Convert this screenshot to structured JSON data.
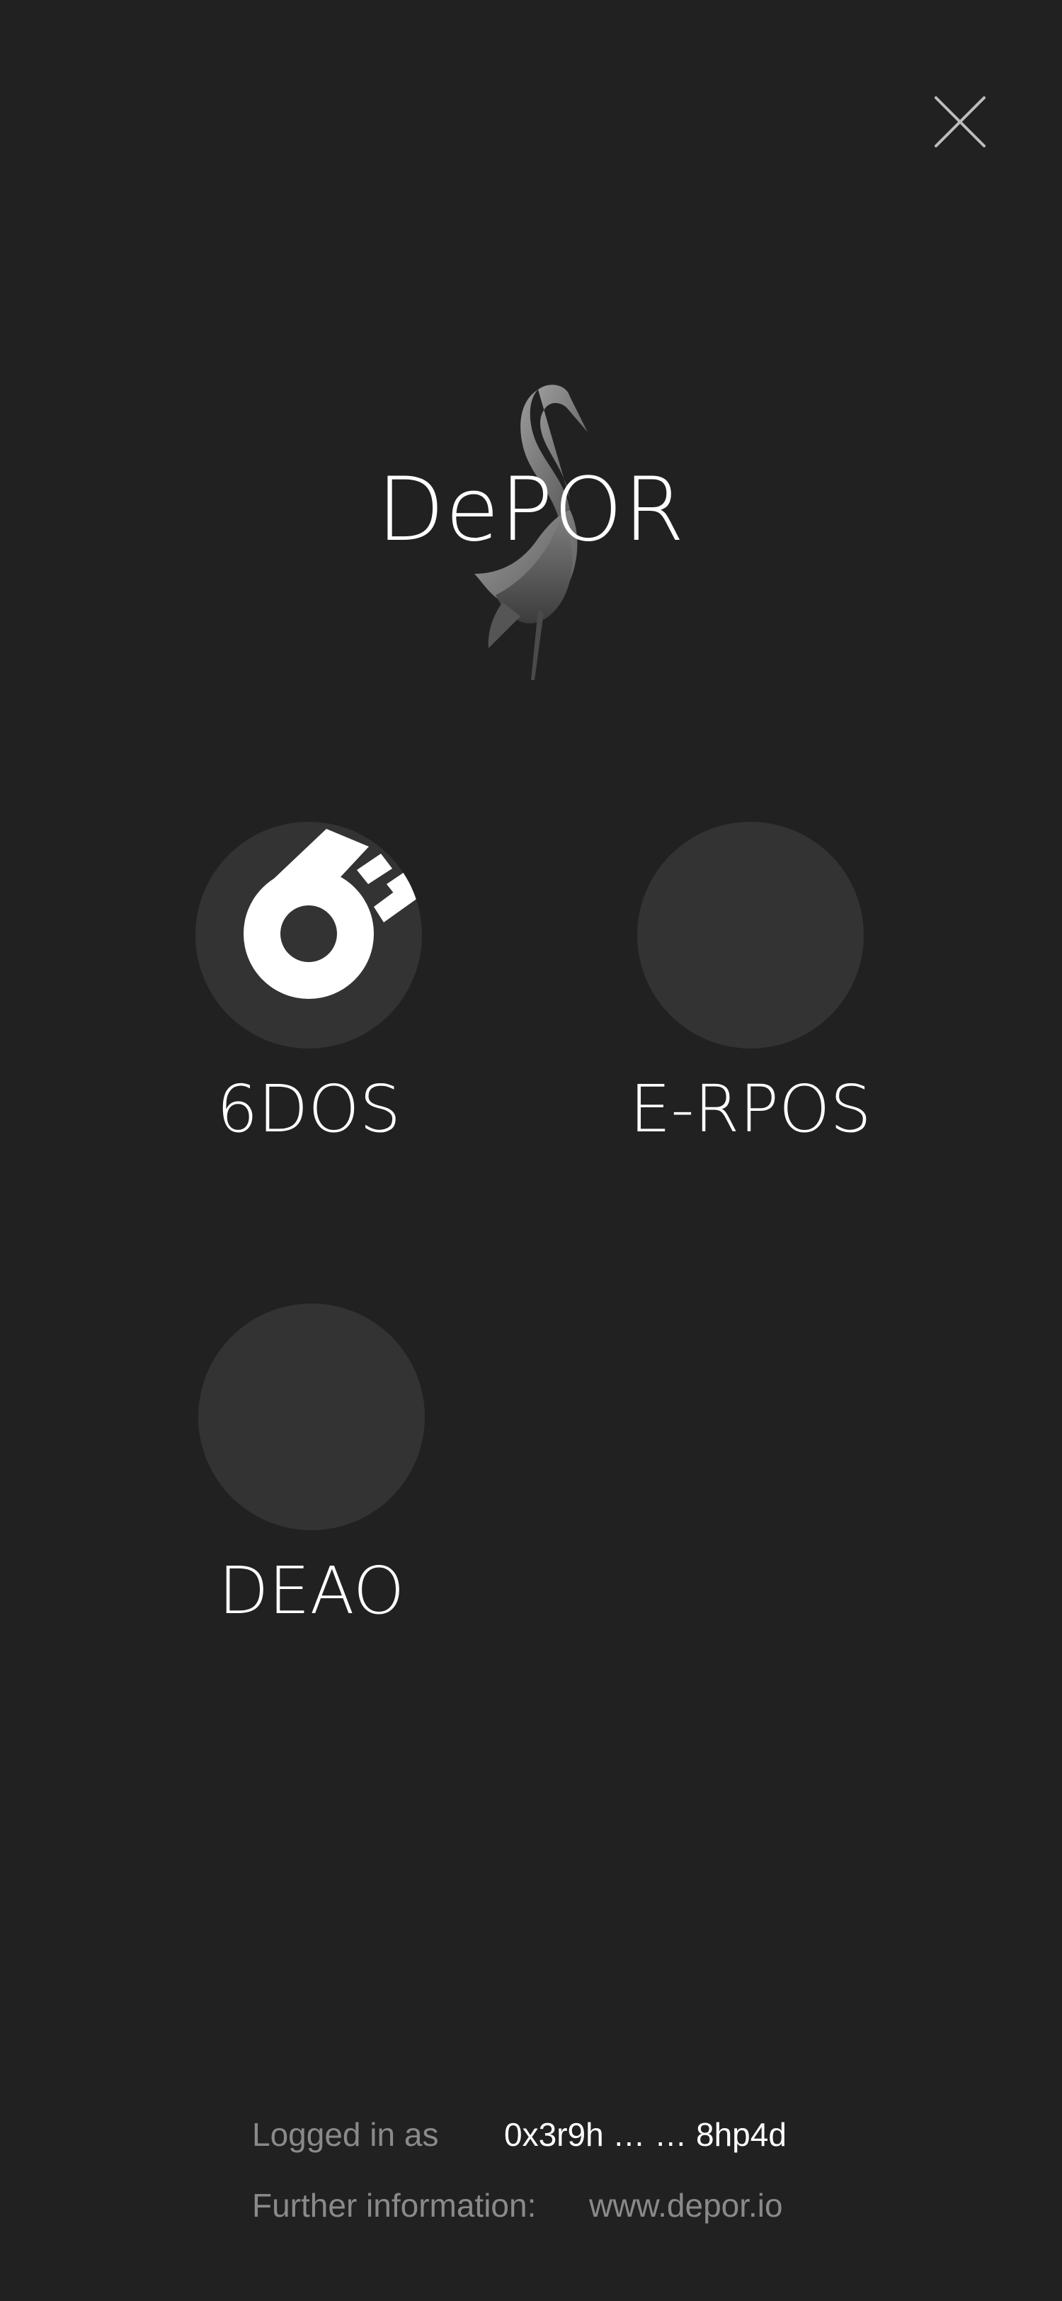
{
  "header": {
    "close_icon": "close-icon"
  },
  "brand": {
    "name": "DePOR",
    "logo_icon": "crane-bird-icon"
  },
  "apps": [
    {
      "label": "6DOS",
      "icon": "sixdos-logo-icon"
    },
    {
      "label": "E-RPOS",
      "icon": ""
    },
    {
      "label": "DEAO",
      "icon": ""
    }
  ],
  "footer": {
    "login_label": "Logged in as",
    "login_value": "0x3r9h … … 8hp4d",
    "info_label": "Further information:",
    "info_value": "www.depor.io"
  },
  "colors": {
    "background": "#212121",
    "tile": "#333333",
    "muted_text": "#8a8a8a",
    "text": "#ffffff"
  }
}
